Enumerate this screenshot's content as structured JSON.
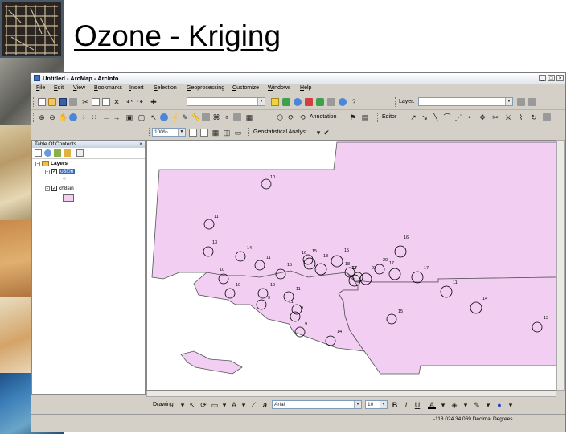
{
  "slide": {
    "title": "Ozone - Kriging"
  },
  "window": {
    "title": "Untitled - ArcMap - ArcInfo",
    "minimize_glyph": "_",
    "maximize_glyph": "□",
    "close_glyph": "×"
  },
  "menubar": {
    "items": [
      "File",
      "Edit",
      "View",
      "Bookmarks",
      "Insert",
      "Selection",
      "Geoprocessing",
      "Customize",
      "Windows",
      "Help"
    ]
  },
  "standard_toolbar": {
    "layer_label": "Layer:",
    "scale_value": ""
  },
  "tools_toolbar": {
    "annotation_label": "Annotation",
    "editor_label": "Editor"
  },
  "analyst_toolbar": {
    "zoom_value": "100%",
    "geostatistical_label": "Geostatistical Analyst"
  },
  "toc": {
    "title": "Table Of Contents",
    "close_glyph": "×",
    "root_label": "Layers",
    "layer1_label": "o3f06",
    "layer2_label": "ch8sin",
    "layer1_symbol": "○",
    "checked_glyph": "✓",
    "collapse_glyph": "−"
  },
  "drawing_toolbar": {
    "drawing_label": "Drawing",
    "font_name": "Arial",
    "font_size": "10",
    "bold": "B",
    "italic": "I",
    "underline": "U",
    "text_tool": "A"
  },
  "statusbar": {
    "coordinates": "-118.024  34.069 Decimal Degrees"
  },
  "map": {
    "fill_color": "#f2cef2",
    "stroke_color": "#555555",
    "stations": [
      {
        "label": "10"
      },
      {
        "label": "11"
      },
      {
        "label": "13"
      },
      {
        "label": "14"
      },
      {
        "label": "11"
      },
      {
        "label": "15"
      },
      {
        "label": "10"
      },
      {
        "label": "10"
      },
      {
        "label": "10"
      },
      {
        "label": "9"
      },
      {
        "label": "11"
      },
      {
        "label": "11"
      },
      {
        "label": "9"
      },
      {
        "label": "9"
      },
      {
        "label": "14"
      },
      {
        "label": "15"
      },
      {
        "label": "16"
      },
      {
        "label": "18"
      },
      {
        "label": "15"
      },
      {
        "label": "17"
      },
      {
        "label": "22"
      },
      {
        "label": "20"
      },
      {
        "label": "16"
      },
      {
        "label": "17"
      },
      {
        "label": "18"
      },
      {
        "label": "17"
      },
      {
        "label": "15"
      },
      {
        "label": "11"
      },
      {
        "label": "14"
      },
      {
        "label": "13"
      },
      {
        "label": "13"
      }
    ]
  }
}
